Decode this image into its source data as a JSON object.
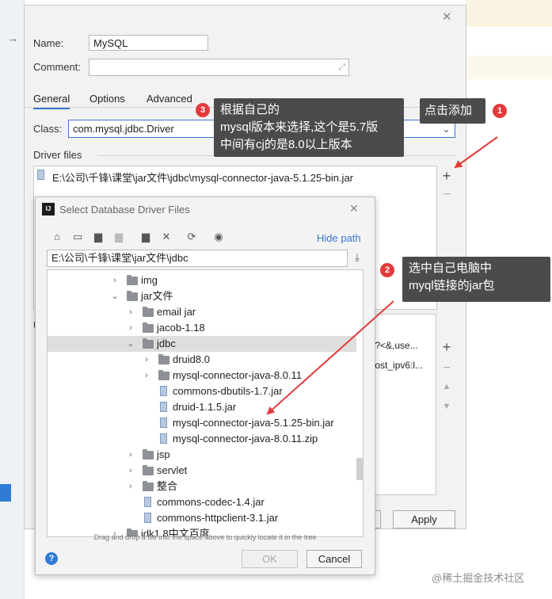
{
  "main_dialog": {
    "name_label": "Name:",
    "name_value": "MySQL",
    "comment_label": "Comment:",
    "tabs": [
      "General",
      "Options",
      "Advanced"
    ],
    "class_label": "Class:",
    "class_value": "com.mysql.jdbc.Driver",
    "driver_files_label": "Driver files",
    "driver_file": "E:\\公司\\千锋\\课堂\\jar文件\\jdbc\\mysql-connector-java-5.1.25-bin.jar",
    "url_label": "U",
    "url_frag1": "?]\\?<&,use...",
    "url_frag2": "t:host_ipv6:l...",
    "cancel_fragment": "el",
    "apply_label": "Apply"
  },
  "file_dialog": {
    "title": "Select Database Driver Files",
    "hide_path": "Hide path",
    "path_value": "E:\\公司\\千锋\\课堂\\jar文件\\jdbc",
    "drop_hint": "Drag and drop a file into the space above to quickly locate it in the tree",
    "ok_label": "OK",
    "cancel_label": "Cancel",
    "tree": [
      {
        "label": "img",
        "type": "folder",
        "depth": 0,
        "chevron": "›"
      },
      {
        "label": "jar文件",
        "type": "folder",
        "depth": 0,
        "chevron": "⌄"
      },
      {
        "label": "email jar",
        "type": "folder",
        "depth": 1,
        "chevron": "›"
      },
      {
        "label": "jacob-1.18",
        "type": "folder",
        "depth": 1,
        "chevron": "›"
      },
      {
        "label": "jdbc",
        "type": "folder",
        "depth": 1,
        "chevron": "⌄",
        "selected": true
      },
      {
        "label": "druid8.0",
        "type": "folder",
        "depth": 2,
        "chevron": "›"
      },
      {
        "label": "mysql-connector-java-8.0.11",
        "type": "folder",
        "depth": 2,
        "chevron": "›"
      },
      {
        "label": "commons-dbutils-1.7.jar",
        "type": "file",
        "depth": 2
      },
      {
        "label": "druid-1.1.5.jar",
        "type": "file",
        "depth": 2
      },
      {
        "label": "mysql-connector-java-5.1.25-bin.jar",
        "type": "file",
        "depth": 2
      },
      {
        "label": "mysql-connector-java-8.0.11.zip",
        "type": "file",
        "depth": 2
      },
      {
        "label": "jsp",
        "type": "folder",
        "depth": 1,
        "chevron": "›"
      },
      {
        "label": "servlet",
        "type": "folder",
        "depth": 1,
        "chevron": "›"
      },
      {
        "label": "整合",
        "type": "folder",
        "depth": 1,
        "chevron": "›"
      },
      {
        "label": "commons-codec-1.4.jar",
        "type": "file",
        "depth": 1
      },
      {
        "label": "commons-httpclient-3.1.jar",
        "type": "file",
        "depth": 1
      },
      {
        "label": "jdk1.8中文百度",
        "type": "folder",
        "depth": 0,
        "chevron": "›"
      }
    ]
  },
  "callouts": {
    "c1": {
      "num": "1",
      "text": "点击添加"
    },
    "c2": {
      "num": "2",
      "line1": "选中自己电脑中",
      "line2": "myql链接的jar包"
    },
    "c3": {
      "num": "3",
      "line1": "根据自己的",
      "line2": "mysql版本来选择,这个是5.7版",
      "line3": "中间有cj的是8.0以上版本"
    }
  },
  "watermark": "@稀土掘金技术社区",
  "colors": {
    "accent": "#3a77d0",
    "callout_bg": "#4b4b4b",
    "badge": "#e33b3b",
    "arrow": "#e33b3b"
  }
}
